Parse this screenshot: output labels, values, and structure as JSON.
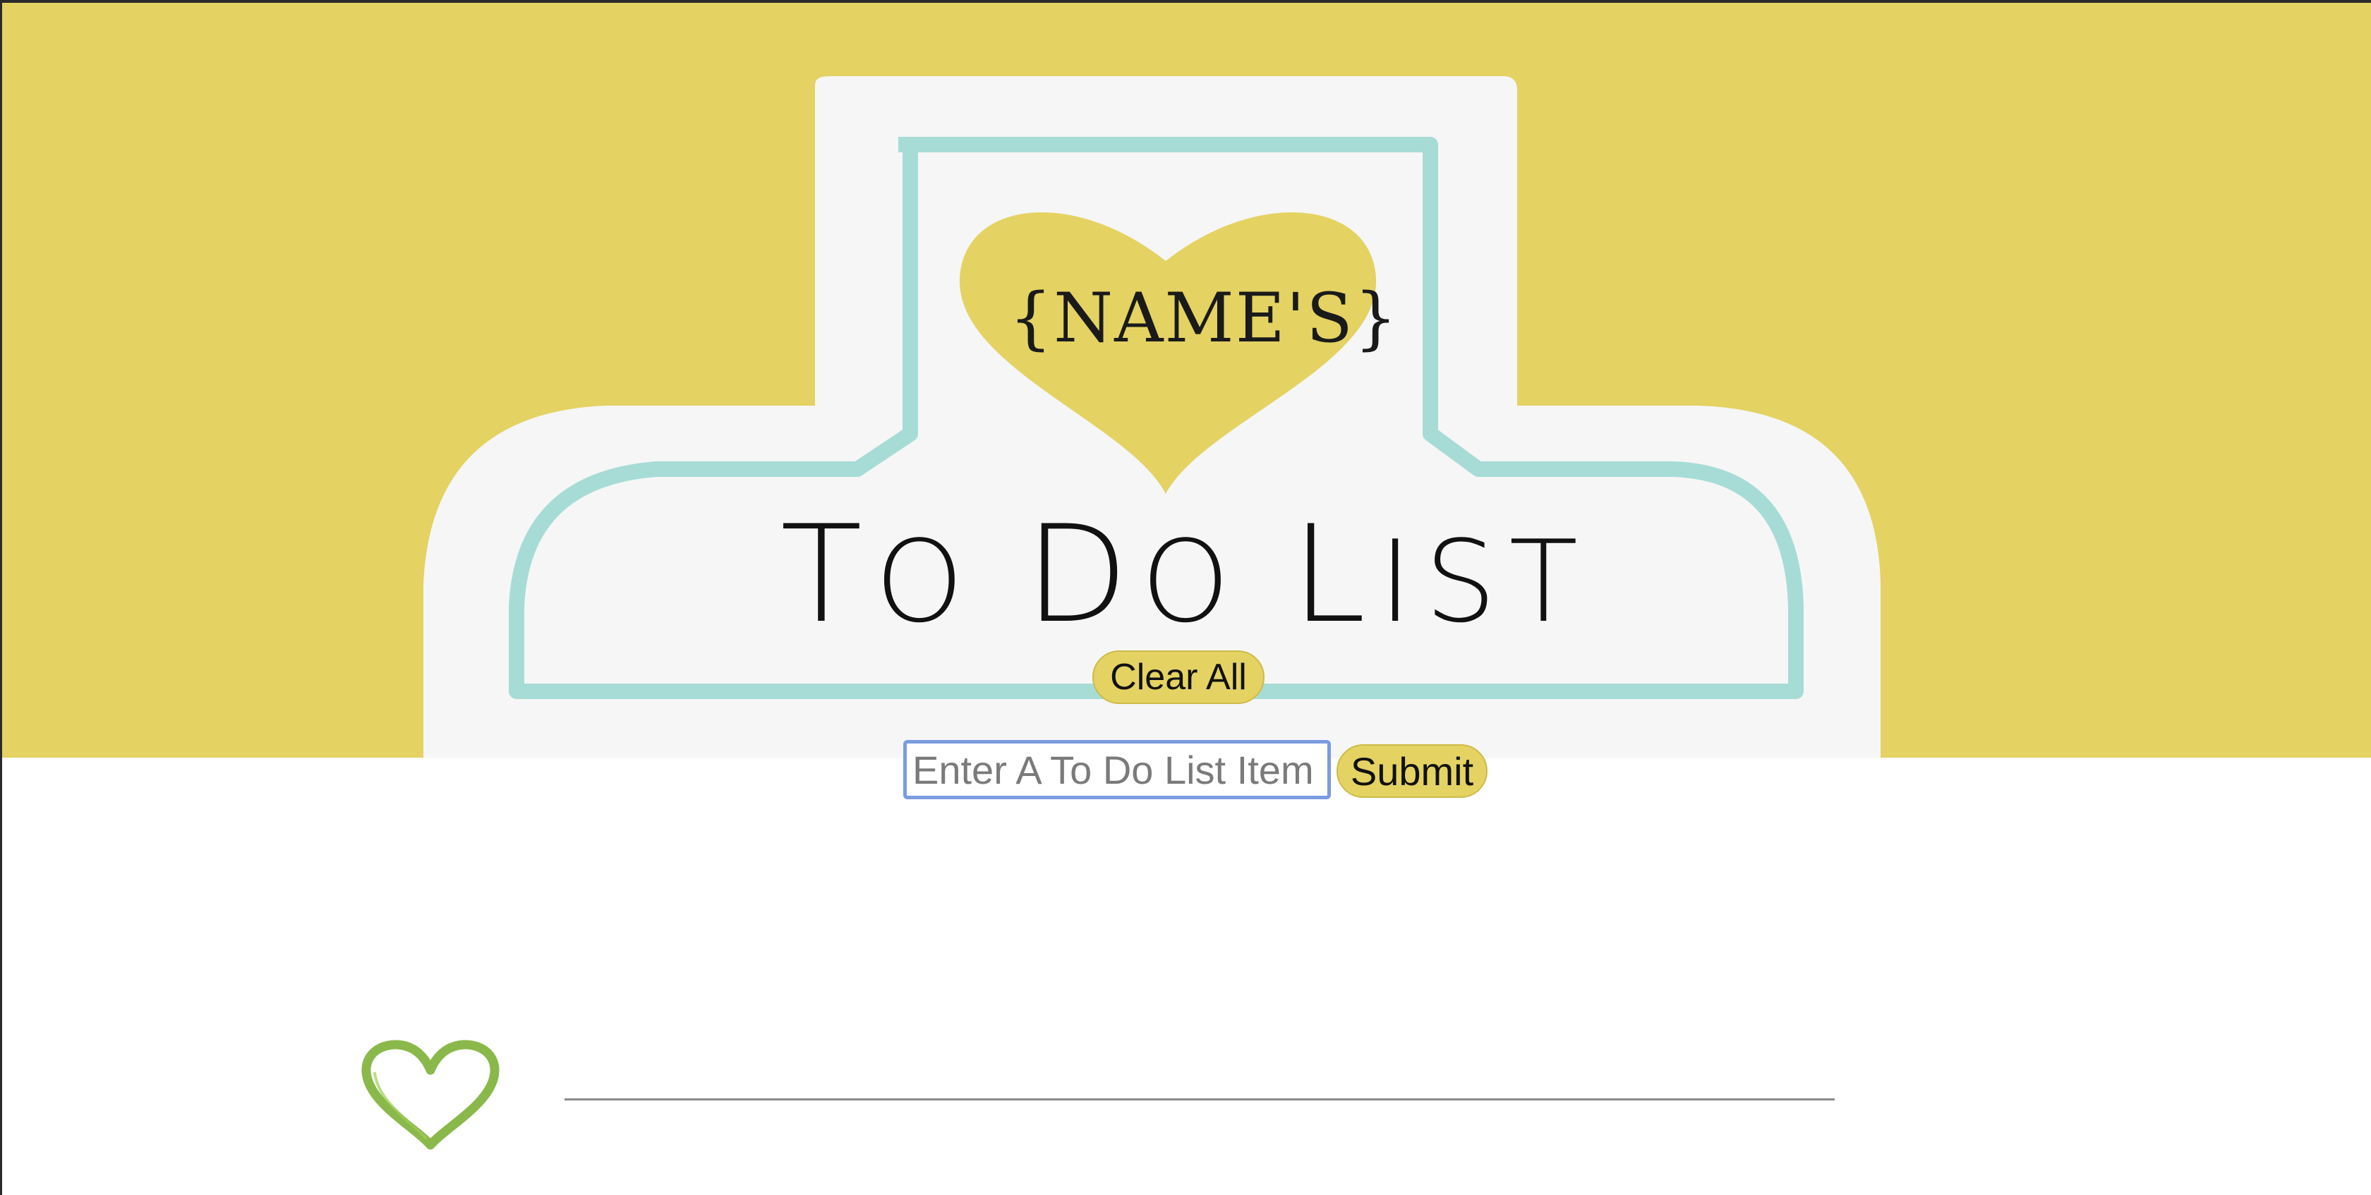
{
  "header": {
    "name_placeholder": "{NAME'S}",
    "title_first": "T",
    "title_rest_1": "O ",
    "title_d": "D",
    "title_rest_2": "O ",
    "title_l": "L",
    "title_rest_3": "IST"
  },
  "controls": {
    "clear_all_label": "Clear All",
    "input_placeholder": "Enter A To Do List Item",
    "input_value": "",
    "submit_label": "Submit"
  },
  "colors": {
    "banner": "#e4d263",
    "card": "#f6f6f6",
    "card_outline": "#a7dcd6",
    "heart_yellow": "#e4d263",
    "heart_green": "#8bb84a",
    "input_focus": "#7a9be0"
  },
  "icons": {
    "header_heart": "heart-icon",
    "list_bullet": "heart-outline-icon"
  }
}
